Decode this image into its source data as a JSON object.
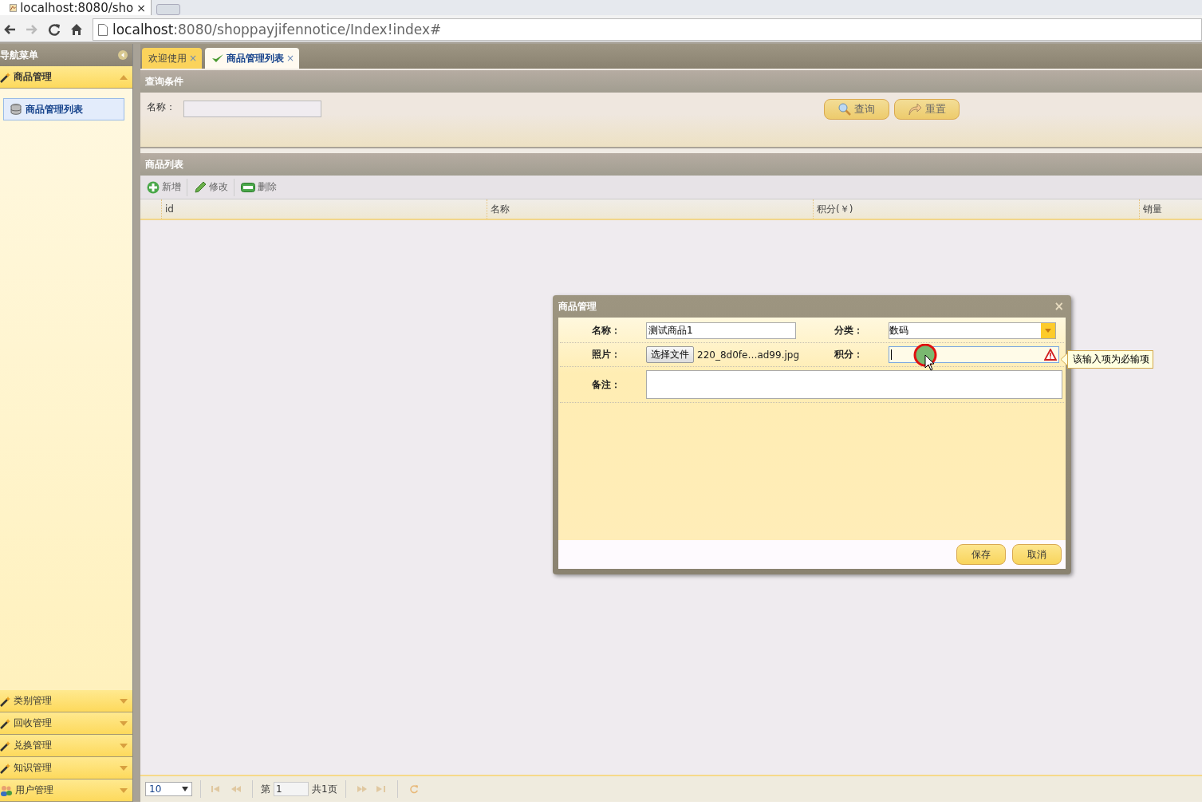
{
  "browser": {
    "tab_title": "localhost:8080/sho",
    "tab_close": "×",
    "address_host": "localhost",
    "address_rest": ":8080/shoppayjifennotice/Index!index#"
  },
  "sidebar": {
    "title": "导航菜单",
    "panels": [
      {
        "label": "商品管理",
        "kind": "tool",
        "expanded": true,
        "children": [
          {
            "label": "商品管理列表",
            "selected": true
          }
        ]
      },
      {
        "label": "类别管理",
        "kind": "tool",
        "expanded": false
      },
      {
        "label": "回收管理",
        "kind": "tool",
        "expanded": false
      },
      {
        "label": "兑换管理",
        "kind": "tool",
        "expanded": false
      },
      {
        "label": "知识管理",
        "kind": "tool",
        "expanded": false
      },
      {
        "label": "用户管理",
        "kind": "users",
        "expanded": false
      }
    ]
  },
  "tabs": [
    {
      "label": "欢迎使用",
      "selected": false,
      "close": "×"
    },
    {
      "label": "商品管理列表",
      "selected": true,
      "close": "×"
    }
  ],
  "query": {
    "title": "查询条件",
    "fields": [
      {
        "label": "名称："
      }
    ],
    "buttons": [
      {
        "label": "查询",
        "kind": "search"
      },
      {
        "label": "重置",
        "kind": "reset"
      }
    ]
  },
  "grid": {
    "title": "商品列表",
    "toolbar": [
      {
        "label": "新增",
        "kind": "add"
      },
      {
        "label": "修改",
        "kind": "edit"
      },
      {
        "label": "删除",
        "kind": "delete"
      }
    ],
    "columns": [
      "id",
      "名称",
      "积分(￥)",
      "销量"
    ],
    "pager": {
      "page_size": "10",
      "page_prefix": "第",
      "page": "1",
      "page_total": "共1页",
      "nav": [
        {
          "kind": "first",
          "disabled": true
        },
        {
          "kind": "prev",
          "disabled": true
        },
        {
          "kind": "next",
          "disabled": true
        },
        {
          "kind": "last",
          "disabled": true
        }
      ]
    }
  },
  "dialog": {
    "title": "商品管理",
    "close": "×",
    "fields": [
      {
        "label": "名称：",
        "kind": "text",
        "value": "测试商品1"
      },
      {
        "label": "分类：",
        "kind": "combo",
        "value": "数码"
      },
      {
        "label": "照片：",
        "kind": "file",
        "button": "选择文件",
        "value": "220_8d0fe…ad99.jpg"
      },
      {
        "label": "积分：",
        "kind": "text",
        "invalid": true,
        "tooltip": "该输入项为必输项"
      },
      {
        "label": "备注：",
        "kind": "textarea"
      }
    ],
    "buttons": [
      {
        "label": "保存"
      },
      {
        "label": "取消"
      }
    ]
  }
}
